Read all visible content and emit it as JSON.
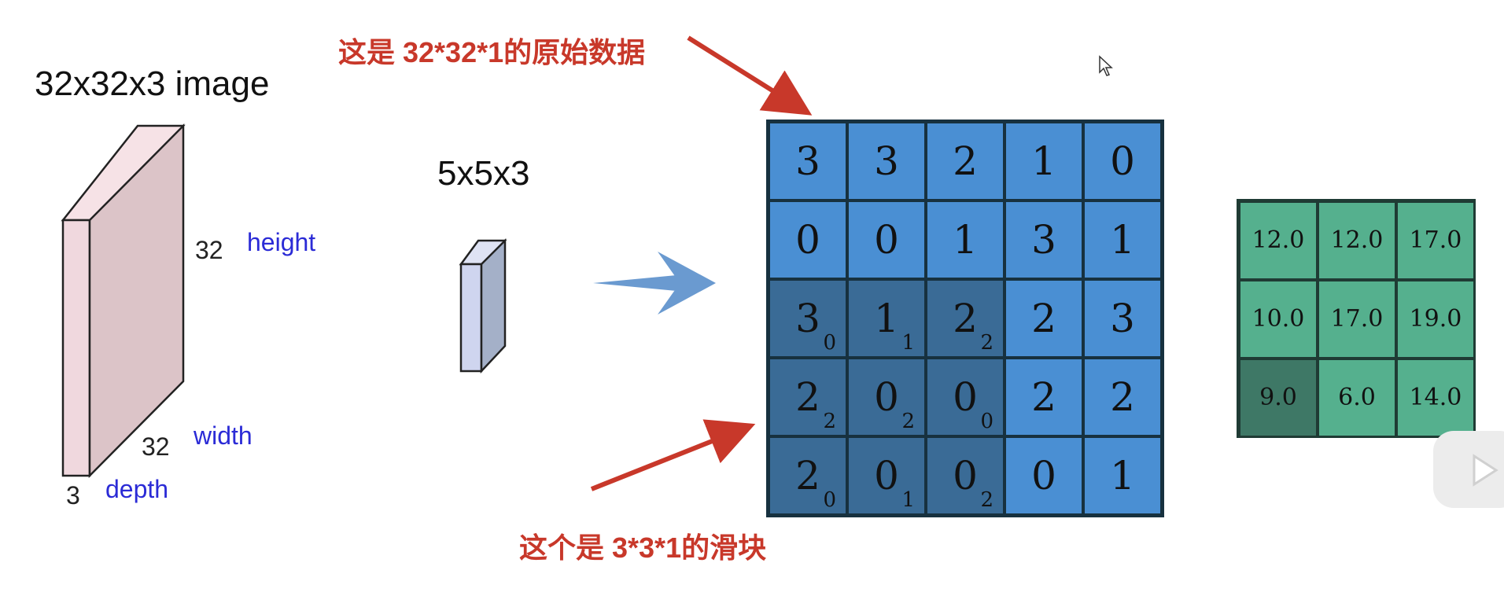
{
  "left": {
    "title": "32x32x3 image",
    "height_num": "32",
    "height_label": "height",
    "width_num": "32",
    "width_label": "width",
    "depth_num": "3",
    "depth_label": "depth"
  },
  "filter": {
    "title": "5x5x3"
  },
  "annotations": {
    "top": "这是 32*32*1的原始数据",
    "bottom": "这个是 3*3*1的滑块"
  },
  "input_grid": {
    "rows": [
      [
        {
          "v": "3",
          "s": ""
        },
        {
          "v": "3",
          "s": ""
        },
        {
          "v": "2",
          "s": ""
        },
        {
          "v": "1",
          "s": ""
        },
        {
          "v": "0",
          "s": ""
        }
      ],
      [
        {
          "v": "0",
          "s": ""
        },
        {
          "v": "0",
          "s": ""
        },
        {
          "v": "1",
          "s": ""
        },
        {
          "v": "3",
          "s": ""
        },
        {
          "v": "1",
          "s": ""
        }
      ],
      [
        {
          "v": "3",
          "s": "0"
        },
        {
          "v": "1",
          "s": "1"
        },
        {
          "v": "2",
          "s": "2"
        },
        {
          "v": "2",
          "s": ""
        },
        {
          "v": "3",
          "s": ""
        }
      ],
      [
        {
          "v": "2",
          "s": "2"
        },
        {
          "v": "0",
          "s": "2"
        },
        {
          "v": "0",
          "s": "0"
        },
        {
          "v": "2",
          "s": ""
        },
        {
          "v": "2",
          "s": ""
        }
      ],
      [
        {
          "v": "2",
          "s": "0"
        },
        {
          "v": "0",
          "s": "1"
        },
        {
          "v": "0",
          "s": "2"
        },
        {
          "v": "0",
          "s": ""
        },
        {
          "v": "1",
          "s": ""
        }
      ]
    ]
  },
  "output_grid": {
    "rows": [
      [
        "12.0",
        "12.0",
        "17.0"
      ],
      [
        "10.0",
        "17.0",
        "19.0"
      ],
      [
        "9.0",
        "6.0",
        "14.0"
      ]
    ]
  },
  "colors": {
    "annotation_red": "#c8382a",
    "grid_blue": "#4a8fd3",
    "grid_blue_dark": "#3a6b96",
    "output_green": "#55b08e",
    "output_green_dark": "#3e7866",
    "dimension_blue": "#2b2bd6"
  }
}
